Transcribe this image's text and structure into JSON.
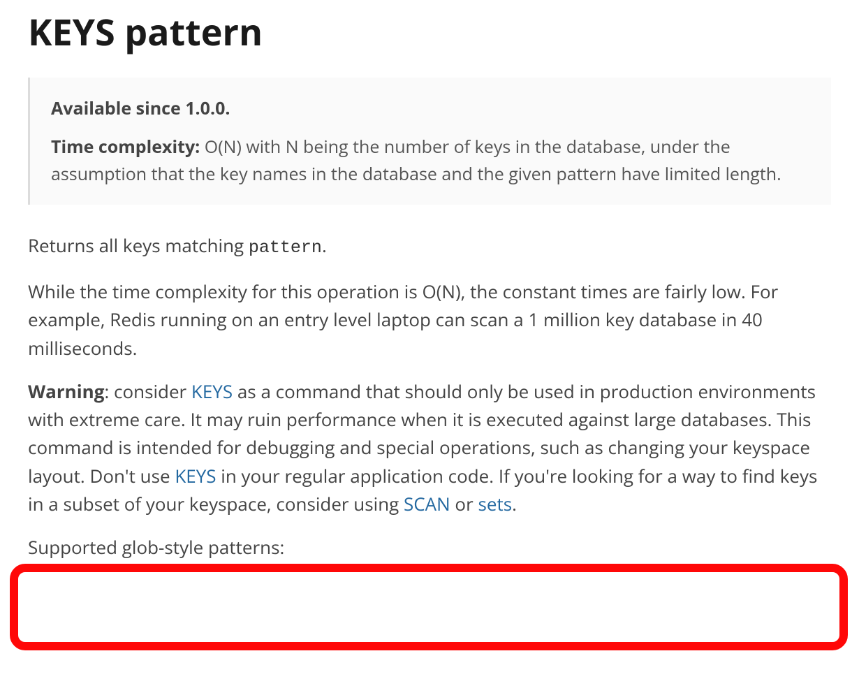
{
  "title": "KEYS pattern",
  "infobox": {
    "available_line": "Available since 1.0.0.",
    "time_complexity_label": "Time complexity:",
    "time_complexity_text": " O(N) with N being the number of keys in the database, under the assumption that the key names in the database and the given pattern have limited length."
  },
  "paragraphs": {
    "returns_prefix": "Returns all keys matching ",
    "returns_code": "pattern",
    "returns_suffix": ".",
    "while_text": "While the time complexity for this operation is O(N), the constant times are fairly low. For example, Redis running on an entry level laptop can scan a 1 million key database in 40 milliseconds.",
    "warning_label": "Warning",
    "warning_pre": ": consider ",
    "warning_link1": "KEYS",
    "warning_mid1": " as a command that should only be used in production environments with extreme care. It may ruin performance when it is executed against large databases. This command is intended for debugging and special operations, such as changing your keyspace layout. Don't use ",
    "warning_link2": "KEYS",
    "warning_mid2": " in your regular application code. If you're looking for a way to find keys in a subset of your keyspace, consider using ",
    "warning_link3": "SCAN",
    "warning_mid3": " or ",
    "warning_link4": "sets",
    "warning_end": ".",
    "supported": "Supported glob-style patterns:"
  }
}
